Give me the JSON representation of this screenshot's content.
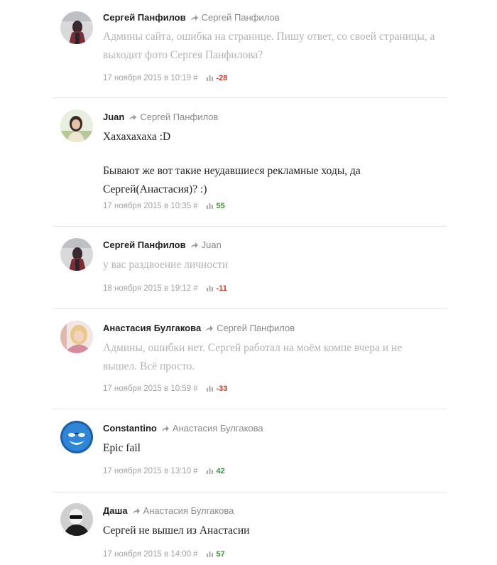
{
  "comments": [
    {
      "author": "Сергей Панфилов",
      "reply_to": "Сергей Панфилов",
      "paragraphs": [
        "Админы сайта, ошибка на странице. Пишу ответ, со своей страницы, а выходит фото Сергея Панфилова?"
      ],
      "text_color": "#b3b3b3",
      "date": "17 ноября 2015 в 10:19",
      "hash": "#",
      "score": "-28",
      "score_color": "#c0392b",
      "avatar": "avatar-sergey"
    },
    {
      "author": "Juan",
      "reply_to": "Сергей Панфилов",
      "paragraphs": [
        "Хахахахаха  :D",
        "Бывают же вот такие неудавшиеся рекламные ходы, да Сергей(Анастасия)? :)"
      ],
      "text_color": "#222222",
      "date": "17 ноября 2015 в 10:35",
      "hash": "#",
      "score": "55",
      "score_color": "#3e8e3e",
      "avatar": "avatar-juan"
    },
    {
      "author": "Сергей Панфилов",
      "reply_to": "Juan",
      "paragraphs": [
        "у вас раздвоение личности"
      ],
      "text_color": "#b3b3b3",
      "date": "18 ноября 2015 в 19:12",
      "hash": "#",
      "score": "-11",
      "score_color": "#c0392b",
      "avatar": "avatar-sergey"
    },
    {
      "author": "Анастасия Булгакова",
      "reply_to": "Сергей Панфилов",
      "paragraphs": [
        "Админы, ошибки нет. Сергей  работал на моём компе вчера  и не вышел. Всё просто."
      ],
      "text_color": "#b3b3b3",
      "date": "17 ноября 2015 в 10:59",
      "hash": "#",
      "score": "-33",
      "score_color": "#c0392b",
      "avatar": "avatar-anastasia"
    },
    {
      "author": "Constantino",
      "reply_to": "Анастасия Булгакова",
      "paragraphs": [
        "Epic fail"
      ],
      "text_color": "#222222",
      "date": "17 ноября 2015 в 13:10",
      "hash": "#",
      "score": "42",
      "score_color": "#3e8e3e",
      "avatar": "avatar-constantino"
    },
    {
      "author": "Даша",
      "reply_to": "Анастасия Булгакова",
      "paragraphs": [
        "Сергей не вышел из Анастасии"
      ],
      "text_color": "#222222",
      "date": "17 ноября 2015 в 14:00",
      "hash": "#",
      "score": "57",
      "score_color": "#3e8e3e",
      "avatar": "avatar-dasha"
    }
  ]
}
